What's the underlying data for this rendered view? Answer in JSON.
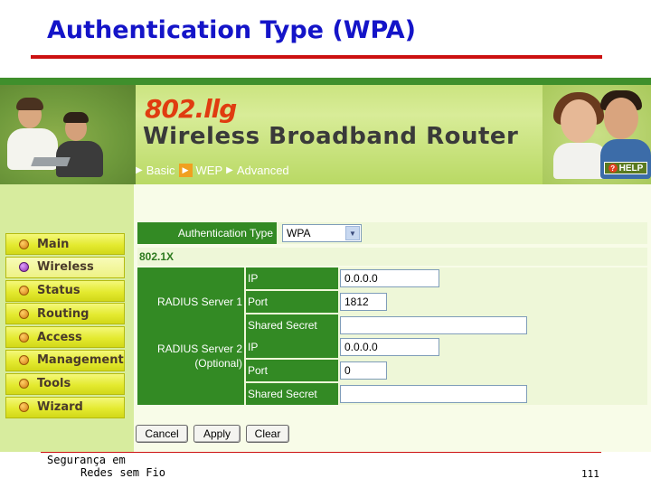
{
  "slide": {
    "title": "Authentication Type (WPA)",
    "footer_line1": "Segurança em",
    "footer_line2": "Redes sem Fio",
    "page_number": "111"
  },
  "router": {
    "model_logo": "802.llg",
    "product_name": "Wireless Broadband Router",
    "nav": [
      "Basic",
      "WEP",
      "Advanced"
    ],
    "help_label": "HELP",
    "menu": [
      {
        "label": "Main",
        "active": false
      },
      {
        "label": "Wireless",
        "active": true
      },
      {
        "label": "Status",
        "active": false
      },
      {
        "label": "Routing",
        "active": false
      },
      {
        "label": "Access",
        "active": false
      },
      {
        "label": "Management",
        "active": false
      },
      {
        "label": "Tools",
        "active": false
      },
      {
        "label": "Wizard",
        "active": false
      }
    ],
    "auth": {
      "label": "Authentication Type",
      "value": "WPA"
    },
    "section_8021x": "802.1X",
    "radius1": {
      "label": "RADIUS Server 1",
      "ip_label": "IP",
      "ip_value": "0.0.0.0",
      "port_label": "Port",
      "port_value": "1812",
      "secret_label": "Shared Secret",
      "secret_value": ""
    },
    "radius2": {
      "label_line1": "RADIUS Server 2",
      "label_line2": "(Optional)",
      "ip_label": "IP",
      "ip_value": "0.0.0.0",
      "port_label": "Port",
      "port_value": "0",
      "secret_label": "Shared Secret",
      "secret_value": ""
    },
    "buttons": {
      "cancel": "Cancel",
      "apply": "Apply",
      "clear": "Clear"
    }
  },
  "colors": {
    "title_blue": "#1414c8",
    "rule_red": "#cc1111",
    "label_green": "#338a24",
    "menu_yellow": "#e4ea30",
    "logo_orange": "#e03c10"
  }
}
